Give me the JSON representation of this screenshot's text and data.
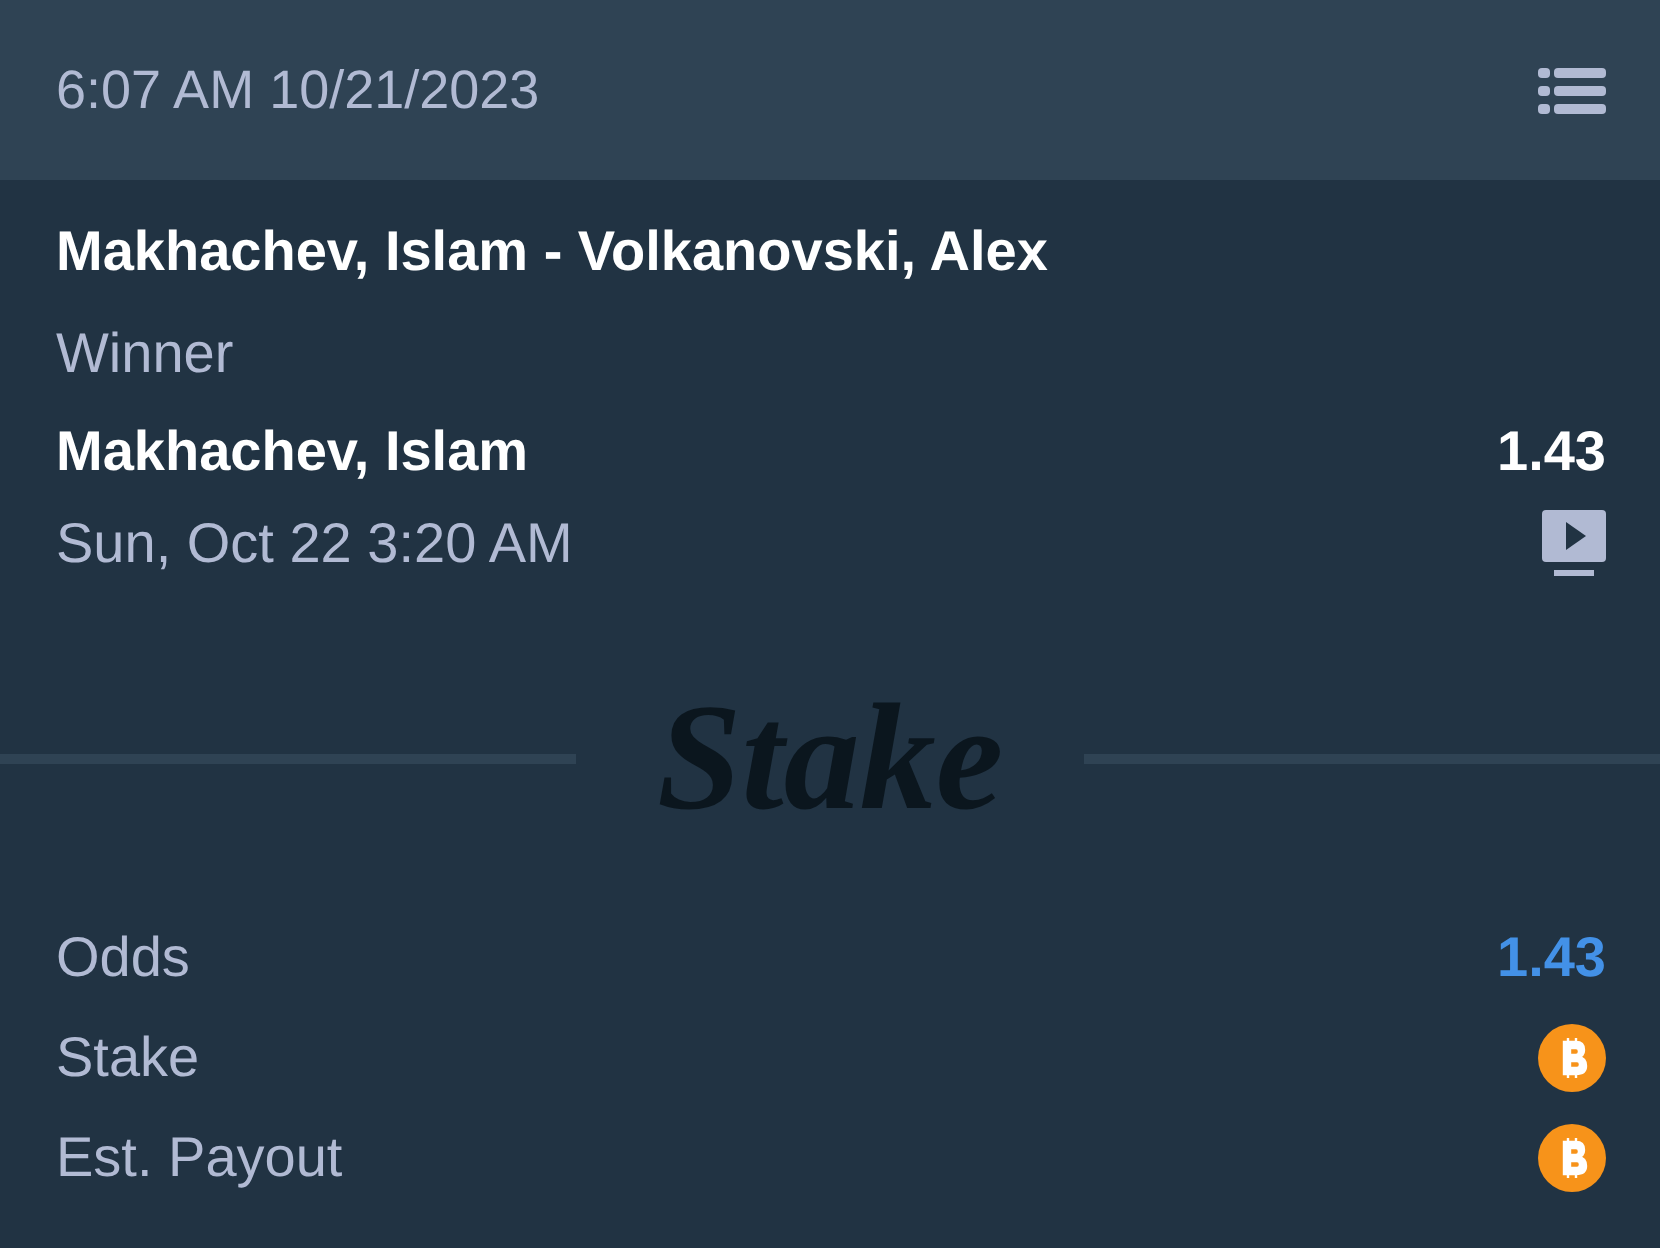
{
  "header": {
    "timestamp": "6:07 AM 10/21/2023"
  },
  "bet": {
    "event": "Makhachev, Islam - Volkanovski, Alex",
    "market": "Winner",
    "selection": "Makhachev, Islam",
    "odds": "1.43",
    "start_time": "Sun, Oct 22 3:20 AM"
  },
  "divider": {
    "logo": "Stake"
  },
  "summary": [
    {
      "label": "Odds",
      "kind": "text",
      "value": "1.43"
    },
    {
      "label": "Stake",
      "kind": "coin"
    },
    {
      "label": "Est. Payout",
      "kind": "coin"
    }
  ]
}
